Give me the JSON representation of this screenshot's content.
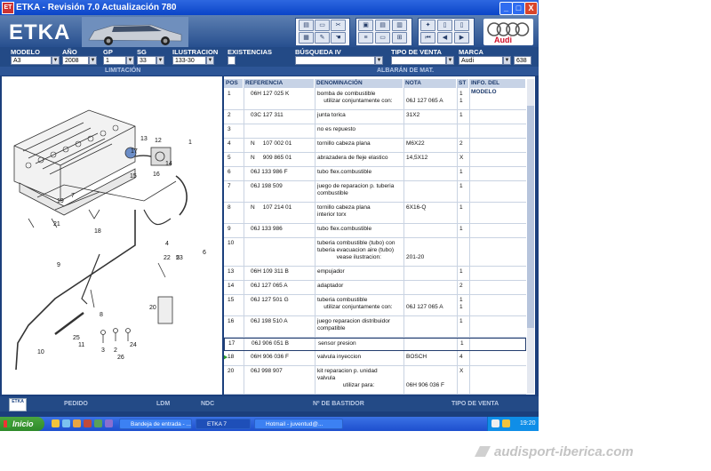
{
  "window": {
    "title": "ETKA - Revisión 7.0 Actualización 780",
    "app_icon": "ET",
    "min": "_",
    "max": "□",
    "close": "X"
  },
  "header": {
    "logo": "ETKA",
    "brand_text": "Audi",
    "accent": "#d0102a"
  },
  "filters": {
    "modelo": {
      "label": "MODELO",
      "value": "A3"
    },
    "ano": {
      "label": "AÑO",
      "value": "2008"
    },
    "gp": {
      "label": "GP",
      "value": "1"
    },
    "sg": {
      "label": "SG",
      "value": "33"
    },
    "ilustracion": {
      "label": "ILUSTRACION",
      "value": "133-30"
    },
    "existencias": {
      "label": "EXISTENCIAS"
    },
    "busqueda": {
      "label": "BÚSQUEDA IV",
      "value": ""
    },
    "tipo_venta": {
      "label": "TIPO DE VENTA",
      "value": ""
    },
    "marca": {
      "label": "MARCA",
      "value": "Audi",
      "code": "638"
    }
  },
  "sections": {
    "left": "LIMITACIÓN",
    "right": "ALBARÁN DE MAT."
  },
  "table": {
    "headers": [
      "POS",
      "REFERENCIA",
      "DENOMINACIÓN",
      "NOTA",
      "ST",
      "INFO. DEL MODELO"
    ],
    "rows": [
      {
        "pos": "1",
        "ref": "06H 127 025 K",
        "den": "bomba de combustible\n    utilizar conjuntamente con:",
        "nota": "\n06J 127 065 A",
        "st": "1\n1",
        "h": 24
      },
      {
        "pos": "2",
        "ref": "03C 127 311",
        "den": "junta torica",
        "nota": "31X2",
        "st": "1",
        "h": 16
      },
      {
        "pos": "3",
        "ref": "",
        "den": "no es repuesto",
        "nota": "",
        "st": "",
        "h": 16
      },
      {
        "pos": "4",
        "ref": "N     107 002 01",
        "den": "tornillo cabeza plana",
        "nota": "M6X22",
        "st": "2",
        "h": 16
      },
      {
        "pos": "5",
        "ref": "N     909 865 01",
        "den": "abrazadera de fleje elastico",
        "nota": "14,5X12",
        "st": "X",
        "h": 16
      },
      {
        "pos": "6",
        "ref": "06J 133 986 F",
        "den": "tubo flex.combustible",
        "nota": "",
        "st": "1",
        "h": 16
      },
      {
        "pos": "7",
        "ref": "06J 198 509",
        "den": "juego de reparacion p. tuberia\ncombustible",
        "nota": "",
        "st": "1",
        "h": 24
      },
      {
        "pos": "8",
        "ref": "N     107 214 01",
        "den": "tornillo cabeza plana\ninterior torx",
        "nota": "6X16-Q",
        "st": "1",
        "h": 24
      },
      {
        "pos": "9",
        "ref": "06J 133 986",
        "den": "tubo flex.combustible",
        "nota": "",
        "st": "1",
        "h": 16
      },
      {
        "pos": "10",
        "ref": "",
        "den": "tuberia combustible (tubo) con\ntuberia evacuacion aire (tubo)\n            vease ilustracion:",
        "nota": "\n\n201-20",
        "st": "",
        "h": 32
      },
      {
        "pos": "13",
        "ref": "06H 109 311 B",
        "den": "empujador",
        "nota": "",
        "st": "1",
        "h": 16
      },
      {
        "pos": "14",
        "ref": "06J 127 065 A",
        "den": "adaptador",
        "nota": "",
        "st": "2",
        "h": 16
      },
      {
        "pos": "15",
        "ref": "06J 127 501 G",
        "den": "tuberia combustible\n    utilizar conjuntamente con:",
        "nota": "\n06J 127 065 A",
        "st": "1\n1",
        "h": 24
      },
      {
        "pos": "16",
        "ref": "06J 198 510 A",
        "den": "juego reparacion distribuidor\ncompatible",
        "nota": "",
        "st": "1",
        "h": 24
      },
      {
        "pos": "17",
        "ref": "06J 906 051 B",
        "den": "sensor presion",
        "nota": "",
        "st": "1",
        "h": 16,
        "selected": true
      },
      {
        "pos": "18",
        "ref": "06H 906 036 F",
        "den": "valvula inyeccion",
        "nota": "BOSCH",
        "st": "4",
        "h": 16,
        "marker": true
      },
      {
        "pos": "20",
        "ref": "06J 998 907",
        "den": "kit reparacion p. unidad\nvalvula\n                utilizar para:",
        "nota": "\n\n06H 906 036 F",
        "st": "X",
        "h": 32
      }
    ]
  },
  "diagram": {
    "callouts": [
      "13",
      "17",
      "12",
      "1",
      "14",
      "15",
      "16",
      "5",
      "4",
      "6",
      "19",
      "7",
      "21",
      "18",
      "10",
      "11",
      "9",
      "8",
      "22",
      "23",
      "20",
      "3",
      "2",
      "25",
      "24",
      "26"
    ]
  },
  "bottom": {
    "buttons": [
      "PEDIDO",
      "LDM",
      "NDC",
      "Nº DE BASTIDOR",
      "TIPO DE VENTA"
    ],
    "logo": "ETKA"
  },
  "taskbar": {
    "start": "Inicio",
    "tasks": [
      "Bandeja de entrada - ...",
      "ETKA 7",
      "Hotmail - juventud@..."
    ],
    "clock": "19:20"
  },
  "watermark": "audisport-iberica.com"
}
